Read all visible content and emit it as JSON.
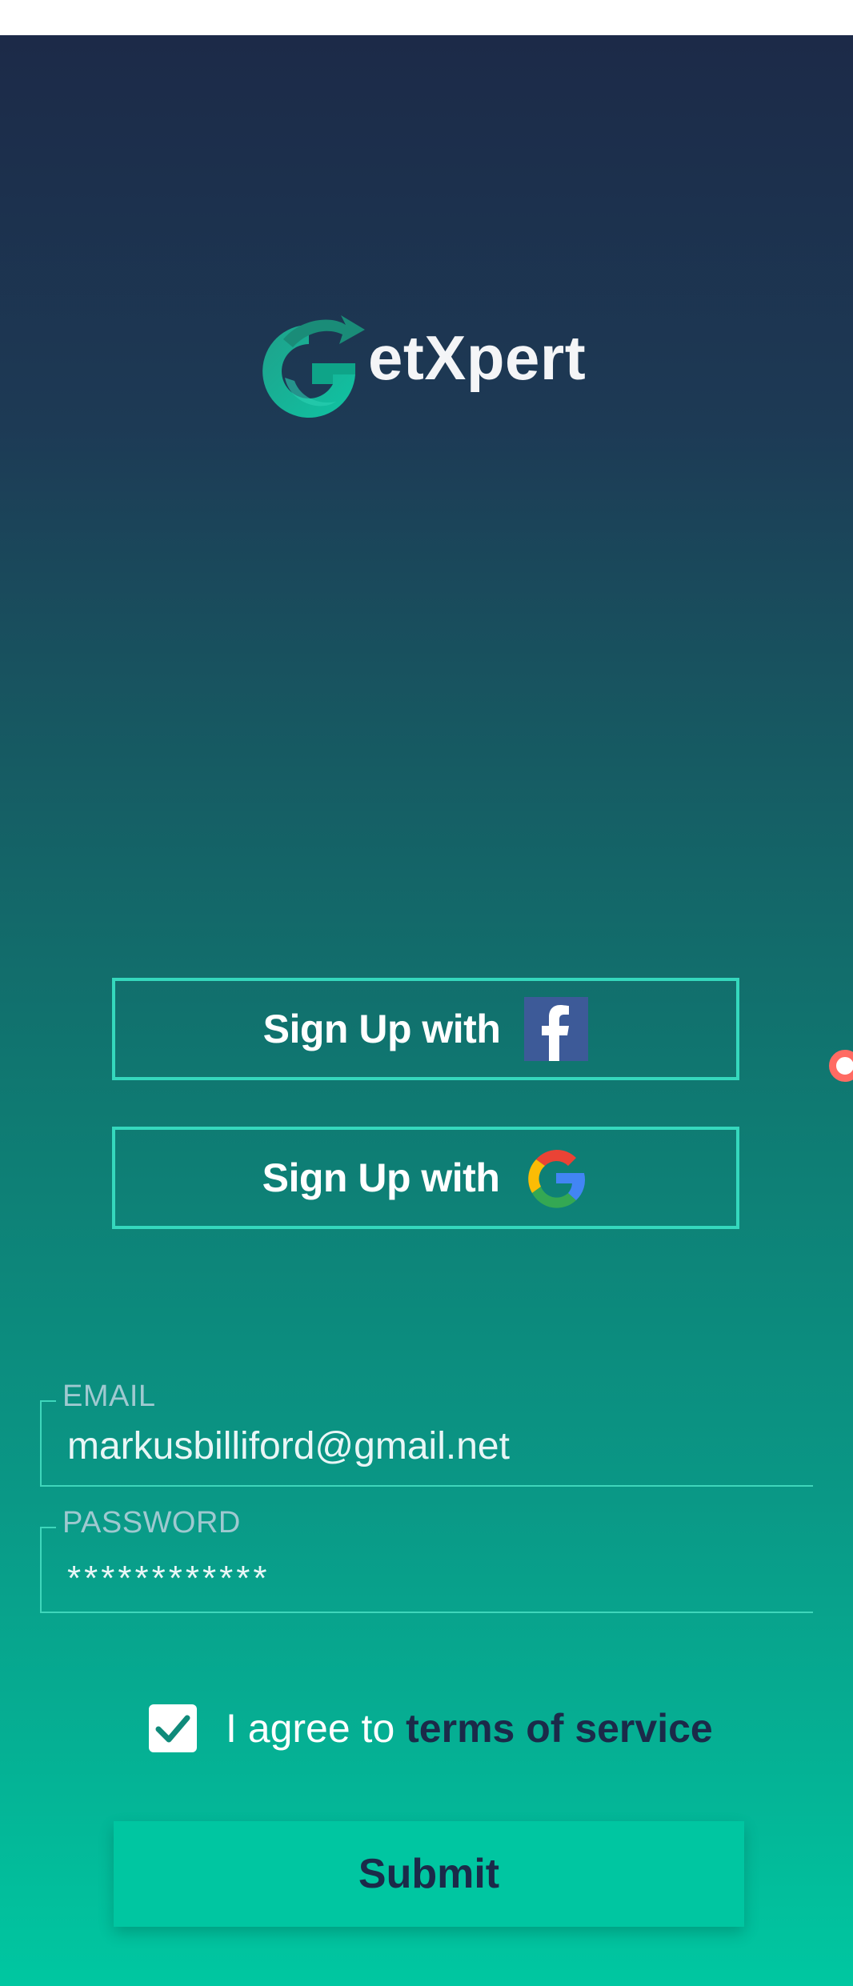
{
  "app": {
    "brand": "etXpert",
    "logo_icon": "getxpert-logo-icon"
  },
  "social": {
    "facebook": {
      "label": "Sign Up with",
      "icon": "facebook-icon",
      "brand_color": "#3d5a98"
    },
    "google": {
      "label": "Sign Up with",
      "icon": "google-icon"
    }
  },
  "form": {
    "email": {
      "label": "EMAIL",
      "value": "markusbilliford@gmail.net"
    },
    "password": {
      "label": "PASSWORD",
      "value": "************"
    }
  },
  "terms": {
    "checked": true,
    "prefix": "I agree to ",
    "link": "terms of service"
  },
  "submit": {
    "label": "Submit"
  },
  "colors": {
    "background_top": "#1c2a48",
    "background_bottom": "#00c7a1",
    "accent": "#35d8bd",
    "submit_bg": "#00c6a1",
    "dark_text": "#1b2a49"
  }
}
